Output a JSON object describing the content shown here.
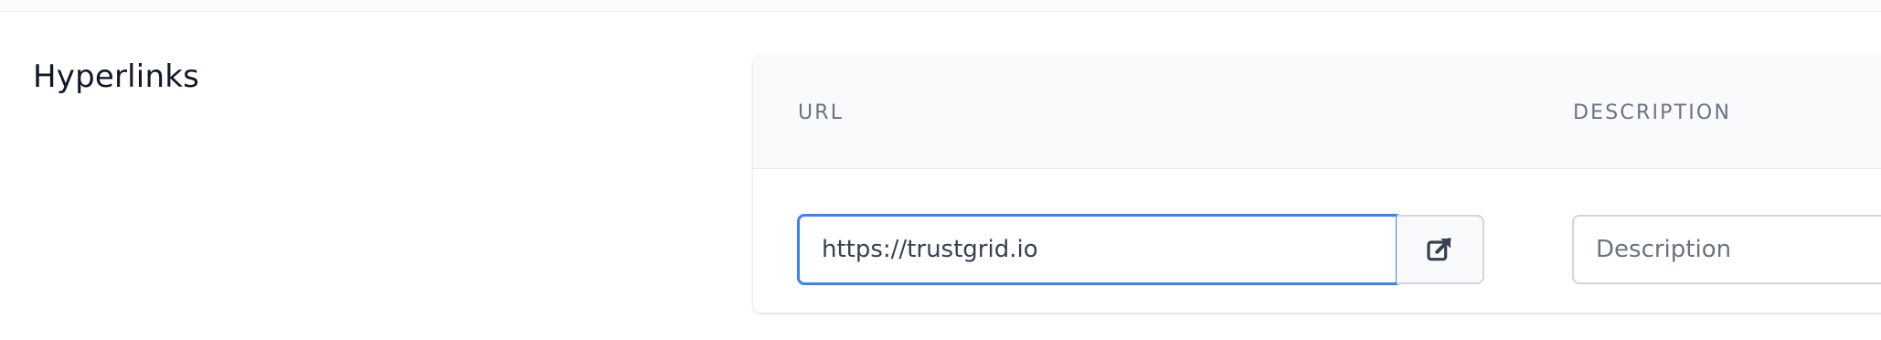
{
  "section": {
    "title": "Hyperlinks"
  },
  "table": {
    "headers": {
      "url": "URL",
      "description": "DESCRIPTION"
    },
    "rows": [
      {
        "url_value": "https://trustgrid.io",
        "description_placeholder": "Description",
        "open_link_icon": "external-link-icon"
      }
    ]
  },
  "colors": {
    "focus_border": "#3b82f6",
    "header_bg": "#f9fafb",
    "header_text": "#6b7280",
    "input_border": "#d1d5db"
  }
}
